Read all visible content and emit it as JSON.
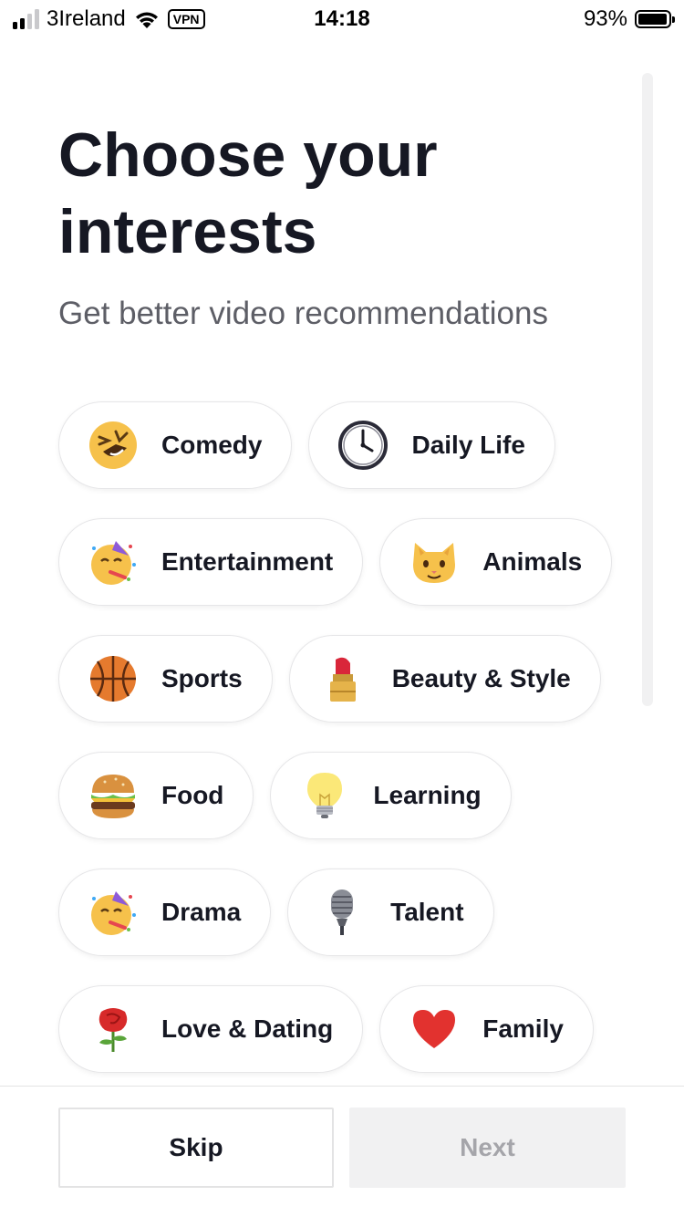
{
  "status_bar": {
    "carrier": "3Ireland",
    "vpn": "VPN",
    "time": "14:18",
    "battery": "93%",
    "battery_level": 0.93,
    "signal_bars": 2
  },
  "header": {
    "title": "Choose your interests",
    "subtitle": "Get better video recommendations"
  },
  "interests": [
    {
      "label": "Comedy",
      "icon": "laughing-face-icon"
    },
    {
      "label": "Daily Life",
      "icon": "clock-icon"
    },
    {
      "label": "Entertainment",
      "icon": "party-face-icon"
    },
    {
      "label": "Animals",
      "icon": "cat-face-icon"
    },
    {
      "label": "Sports",
      "icon": "basketball-icon"
    },
    {
      "label": "Beauty & Style",
      "icon": "lipstick-icon"
    },
    {
      "label": "Food",
      "icon": "burger-icon"
    },
    {
      "label": "Learning",
      "icon": "lightbulb-icon"
    },
    {
      "label": "Drama",
      "icon": "party-face-icon"
    },
    {
      "label": "Talent",
      "icon": "microphone-icon"
    },
    {
      "label": "Love & Dating",
      "icon": "rose-icon"
    },
    {
      "label": "Family",
      "icon": "heart-icon"
    }
  ],
  "footer": {
    "skip_label": "Skip",
    "next_label": "Next"
  },
  "colors": {
    "text_primary": "#161823",
    "text_secondary": "#5d5e66",
    "chip_border": "#e6e6e8",
    "next_disabled_bg": "#f1f1f2",
    "next_disabled_text": "#a5a5aa"
  }
}
